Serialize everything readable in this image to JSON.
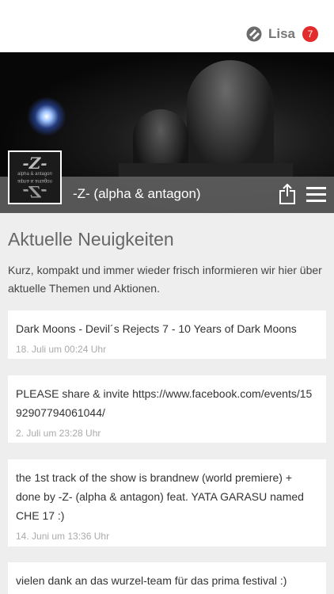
{
  "header": {
    "user_name": "Lisa",
    "notification_count": "7",
    "logo_icon": "brand-logo-icon"
  },
  "profile": {
    "name": "-Z- (alpha & antagon)",
    "thumbnail_text_top": "-Z-",
    "thumbnail_caption": "alpha & antagon",
    "share_icon": "share-icon",
    "menu_icon": "hamburger-menu-icon"
  },
  "news": {
    "heading": "Aktuelle Neuigkeiten",
    "intro": "Kurz, kompakt und immer wieder frisch informieren wir hier über aktuelle Themen und Aktionen.",
    "items": [
      {
        "text": "Dark Moons - Devil´s Rejects 7 - 10 Years of Dark Moons",
        "date": "18. Juli um 00:24 Uhr"
      },
      {
        "text": "PLEASE share & invite https://www.facebook.com/events/1592907794061044/",
        "date": "2. Juli um 23:28 Uhr"
      },
      {
        "text": "the 1st track of the show is brandnew (world premiere) + done by -Z- (alpha & antagon) feat. YATA GARASU named CHE 17 :)",
        "date": "14. Juni um 13:36 Uhr"
      },
      {
        "text": "vielen dank an das wurzel-team für das prima festival :)",
        "date": ""
      }
    ]
  },
  "colors": {
    "badge": "#e32b2b",
    "band": "#646464",
    "background": "#eeeeee"
  }
}
